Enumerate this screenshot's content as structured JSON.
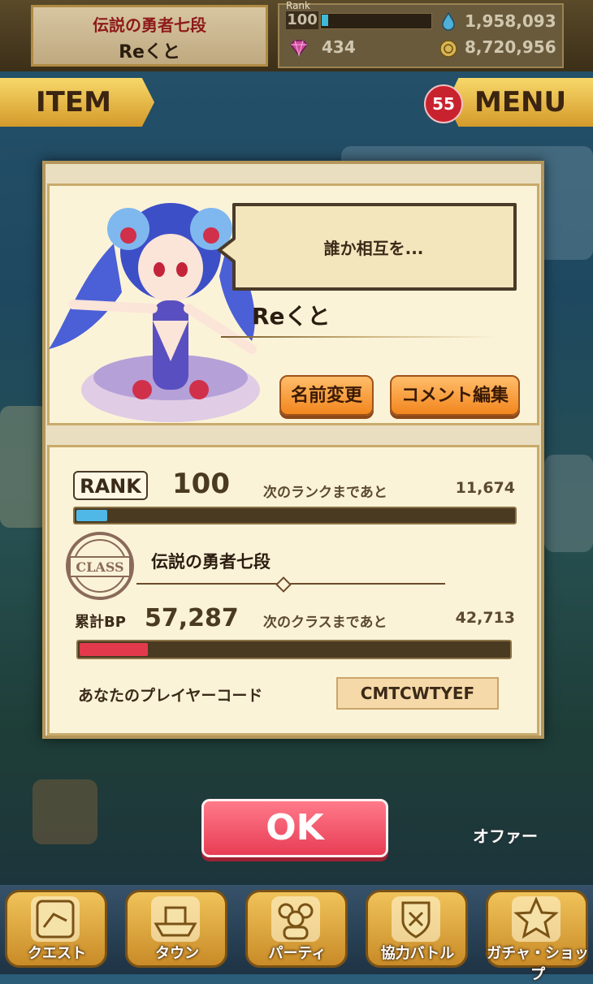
{
  "header": {
    "class_name": "伝説の勇者七段",
    "player_name": "Reくと",
    "rank_tag": "Rank",
    "rank": "100",
    "stamina": "1,958,093",
    "gems": "434",
    "coins": "8,720,956"
  },
  "nav": {
    "item_label": "ITEM",
    "menu_label": "MENU",
    "menu_badge": "55"
  },
  "profile": {
    "comment": "誰か相互を...",
    "name": "Reくと",
    "rename_label": "名前変更",
    "comment_edit_label": "コメント編集"
  },
  "stats": {
    "rank_label": "RANK",
    "rank_value": "100",
    "next_rank_text": "次のランクまであと",
    "next_rank_value": "11,674",
    "rank_progress": 0.07,
    "class_title": "伝説の勇者七段",
    "class_badge_text": "CLASS",
    "bp_label": "累計BP",
    "bp_value": "57,287",
    "next_class_text": "次のクラスまであと",
    "next_class_value": "42,713",
    "class_progress": 0.16,
    "player_code_label": "あなたのプレイヤーコード",
    "player_code": "CMTCWTYEF"
  },
  "ok_label": "OK",
  "offer_label": "オファー",
  "bottom_nav": [
    {
      "label": "クエスト",
      "icon": "quest-map-icon"
    },
    {
      "label": "タウン",
      "icon": "town-ship-icon"
    },
    {
      "label": "パーティ",
      "icon": "party-people-icon"
    },
    {
      "label": "協力バトル",
      "icon": "coop-battle-icon"
    },
    {
      "label": "ガチャ・ショップ",
      "icon": "gacha-star-icon"
    }
  ],
  "colors": {
    "rank_bar": "#4fb8e6",
    "class_bar": "#e23a4c",
    "ok_button": "#ee4a60",
    "orange_button": "#f59b3a"
  }
}
